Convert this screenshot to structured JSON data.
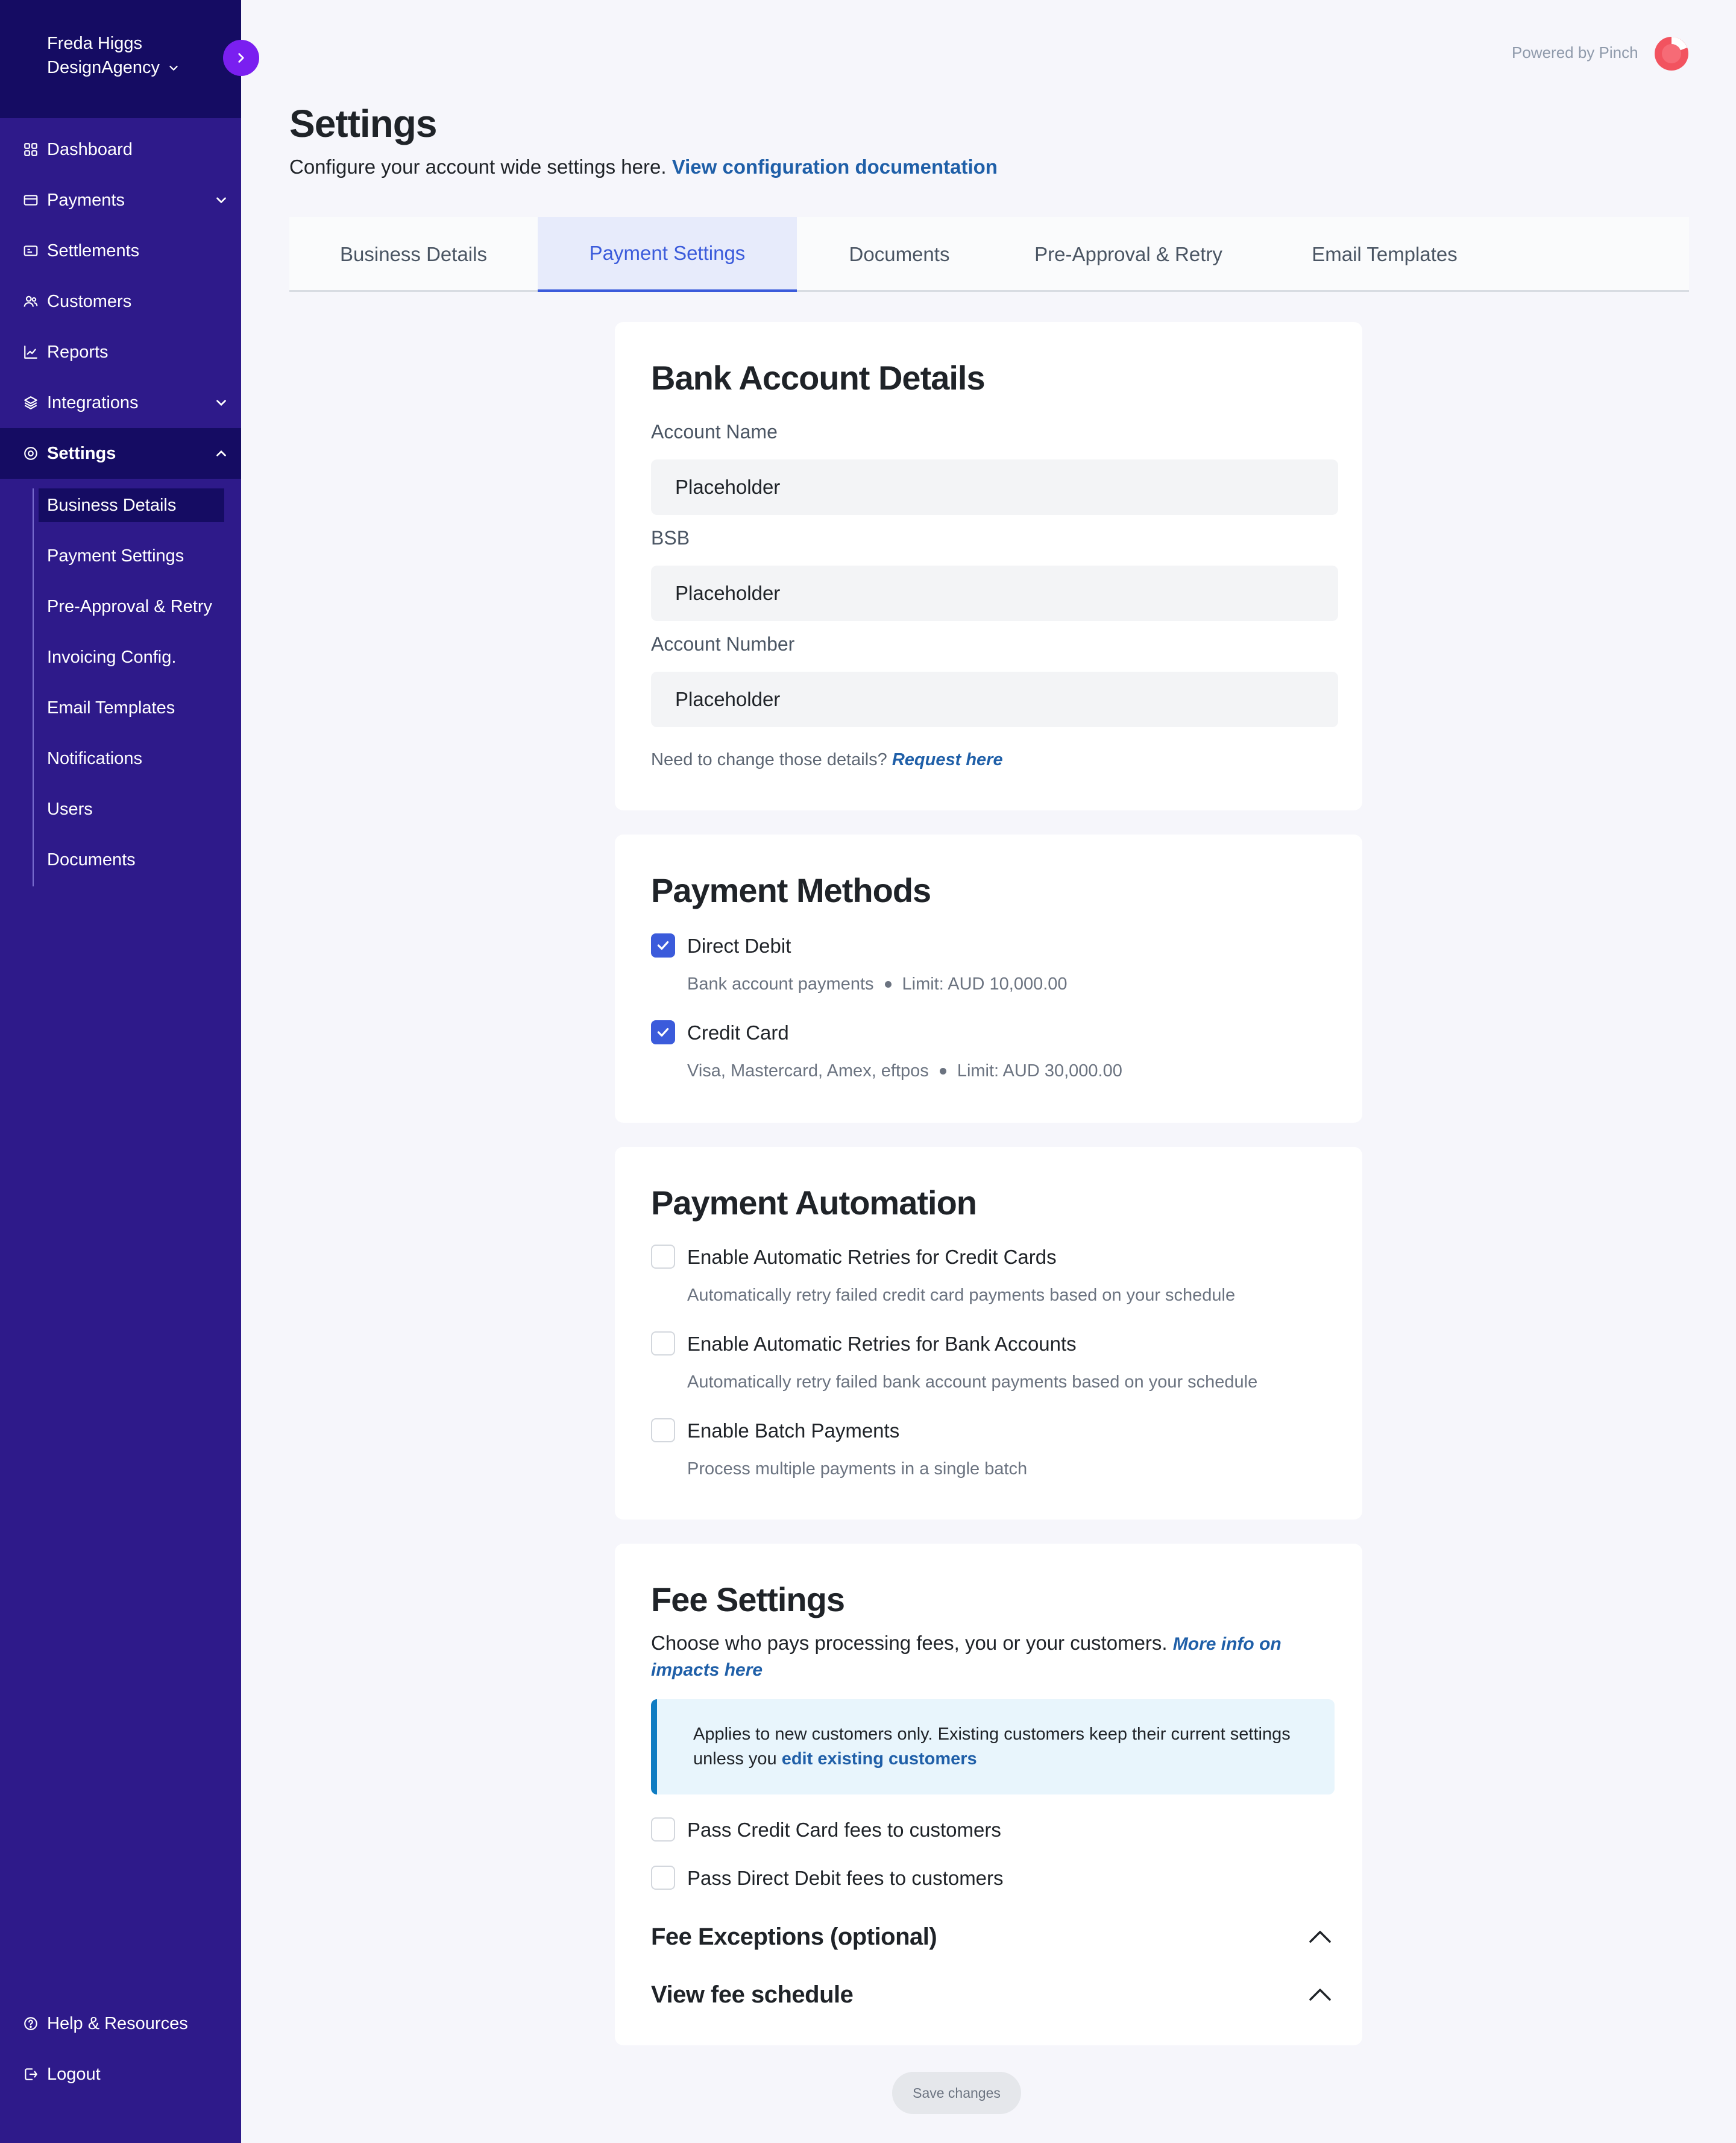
{
  "user": {
    "name": "Freda Higgs",
    "org": "DesignAgency"
  },
  "nav": {
    "items": [
      {
        "label": "Dashboard",
        "icon": "dashboard-icon"
      },
      {
        "label": "Payments",
        "icon": "card-icon"
      },
      {
        "label": "Settlements",
        "icon": "settlements-icon"
      },
      {
        "label": "Customers",
        "icon": "users-icon"
      },
      {
        "label": "Reports",
        "icon": "chart-icon"
      },
      {
        "label": "Integrations",
        "icon": "layers-icon"
      },
      {
        "label": "Settings",
        "icon": "gear-icon"
      }
    ],
    "sub_items": [
      "Business Details",
      "Payment Settings",
      "Pre-Approval & Retry",
      "Invoicing Config.",
      "Email Templates",
      "Notifications",
      "Users",
      "Documents"
    ],
    "footer": [
      {
        "label": "Help & Resources",
        "icon": "help-icon"
      },
      {
        "label": "Logout",
        "icon": "logout-icon"
      }
    ]
  },
  "header": {
    "powered_by": "Powered by Pinch",
    "title": "Settings",
    "subtitle": "Configure your account wide settings here.",
    "doc_link": "View configuration documentation"
  },
  "tabs": [
    "Business Details",
    "Payment Settings",
    "Documents",
    "Pre-Approval & Retry",
    "Email Templates"
  ],
  "active_tab": "Payment Settings",
  "bank": {
    "title": "Bank Account Details",
    "fields": [
      {
        "label": "Account Name",
        "value": "Placeholder"
      },
      {
        "label": "BSB",
        "value": "Placeholder"
      },
      {
        "label": "Account Number",
        "value": "Placeholder"
      }
    ],
    "helper": "Need to change those details?",
    "helper_link": "Request here"
  },
  "methods": {
    "title": "Payment Methods",
    "items": [
      {
        "label": "Direct Debit",
        "desc": "Bank account payments",
        "limit": "Limit: AUD 10,000.00",
        "checked": true
      },
      {
        "label": "Credit Card",
        "desc": "Visa, Mastercard, Amex, eftpos",
        "limit": "Limit: AUD 30,000.00",
        "checked": true
      }
    ]
  },
  "automation": {
    "title": "Payment Automation",
    "items": [
      {
        "label": "Enable Automatic Retries for Credit Cards",
        "desc": "Automatically retry failed credit card payments based on your schedule",
        "checked": false
      },
      {
        "label": "Enable Automatic Retries for Bank Accounts",
        "desc": "Automatically retry failed bank account payments based on your schedule",
        "checked": false
      },
      {
        "label": "Enable Batch Payments",
        "desc": "Process multiple payments in a single batch",
        "checked": false
      }
    ]
  },
  "fees": {
    "title": "Fee Settings",
    "desc": "Choose who pays processing fees, you or your customers.",
    "desc_link": "More info on impacts here",
    "info": "Applies to new customers only. Existing customers keep their current settings unless you",
    "info_link": "edit existing customers",
    "options": [
      {
        "label": "Pass Credit Card fees to customers",
        "checked": false
      },
      {
        "label": "Pass Direct Debit fees to customers",
        "checked": false
      }
    ],
    "accordions": [
      "Fee Exceptions (optional)",
      "View fee schedule"
    ]
  },
  "save_label": "Save changes",
  "colors": {
    "sidebar": "#2e1a8a",
    "sidebar_dark": "#150c63",
    "accent": "#3b5bdb",
    "link": "#1f5fa8",
    "toggle": "#7a1ff0"
  }
}
